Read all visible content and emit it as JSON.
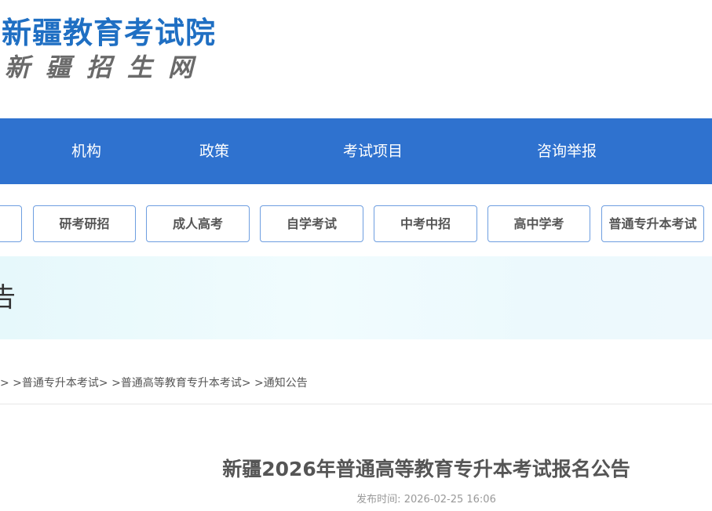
{
  "header": {
    "site_title": "新疆教育考试院",
    "site_subtitle": "新疆招生网"
  },
  "nav": {
    "items": [
      {
        "label": "机构"
      },
      {
        "label": "政策"
      },
      {
        "label": "考试项目"
      },
      {
        "label": "咨询举报"
      }
    ]
  },
  "categories": {
    "items": [
      {
        "label": ""
      },
      {
        "label": "研考研招"
      },
      {
        "label": "成人高考"
      },
      {
        "label": "自学考试"
      },
      {
        "label": "中考中招"
      },
      {
        "label": "高中学考"
      },
      {
        "label": "普通专升本考试"
      }
    ]
  },
  "banner": {
    "text": "告"
  },
  "breadcrumb": {
    "sep": "> >",
    "items": [
      {
        "label": "普通专升本考试"
      },
      {
        "label": "普通高等教育专升本考试"
      },
      {
        "label": "通知公告"
      }
    ]
  },
  "article": {
    "title": "新疆2026年普通高等教育专升本考试报名公告",
    "publish_label": "发布时间:",
    "publish_time": "2026-02-25 16:06"
  },
  "colors": {
    "brand_blue": "#1f6fc3",
    "nav_blue": "#2f72cf",
    "banner_bg": "#eef9fd"
  }
}
